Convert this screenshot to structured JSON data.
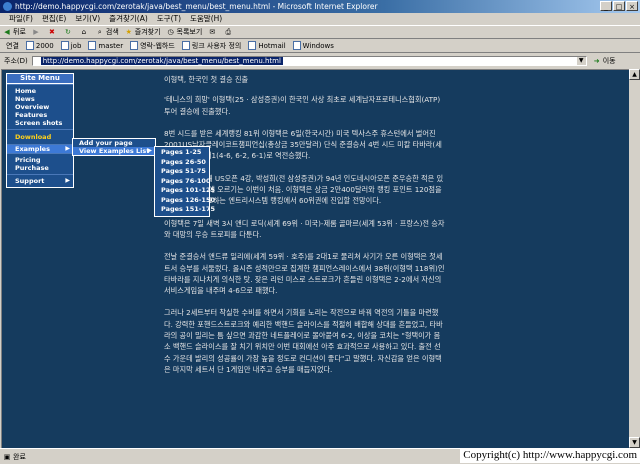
{
  "window": {
    "title": "http://demo.happycgi.com/zerotak/java/best_menu/best_menu.html - Microsoft Internet Explorer"
  },
  "menubar": [
    "파일(F)",
    "편집(E)",
    "보기(V)",
    "즐겨찾기(A)",
    "도구(T)",
    "도움말(H)"
  ],
  "toolbar": {
    "back": "뒤로",
    "search": "검색",
    "favorites": "즐겨찾기",
    "history": "목록보기"
  },
  "links": {
    "label": "연결",
    "items": [
      "2000",
      "job",
      "master",
      "영락-웹하드",
      "링크 사용자 정의",
      "Hotmail",
      "Windows"
    ]
  },
  "address": {
    "label": "주소(D)",
    "url": "http://demo.happycgi.com/zerotak/java/best_menu/best_menu.html",
    "go": "이동"
  },
  "site_menu": {
    "header": "Site Menu",
    "group1": [
      "Home",
      "News",
      "Overview",
      "Features",
      "Screen shots"
    ],
    "download": "Download",
    "examples": "Examples",
    "group2": [
      "Pricing",
      "Purchase"
    ],
    "support": "Support",
    "examples_sub": [
      "Add your page",
      "View Examples List"
    ],
    "pages": [
      "Pages 1-25",
      "Pages 26-50",
      "Pages 51-75",
      "Pages 76-100",
      "Pages 101-125",
      "Pages 126-150",
      "Pages 151-175"
    ]
  },
  "article": {
    "title": "이형택, 한국인 첫 결승 진출",
    "p1": "'테니스의 희망' 이형택(25 · 삼성증권)이 한국인 사상 최초로 세계남자프로테니스협회(ATP) 투어 결승에 진출했다.",
    "p2": "8번 시드를 받은 세계랭킹 81위 이형택은 6일(한국시간) 미국 텍사스주 휴스턴에서 벌어진 2001US남자클레이코트챔피언십(총상금 35만달러) 단식 준결승서 4번 시드 미칼 타바라(세계 73위)에 2대1(4-6, 6-2, 6-1)로 역전승했다.",
    "p3": "이형택은 지난해 US오픈 4강, 박성희(전 삼성증권)가 94년 인도네시아오픈 준우승한 적은 있으나 투어 결승에 오르기는 이번이 처음. 이형택은 상금 2만400달러와 랭킹 포인트 120점을 확보해 9일 발표하는 엔트리시스템 랭킹에서 60위권에 진입할 전망이다.",
    "p4": "이형택은 7일 새벽 3시 앤디 로딕(세계 69위 · 미국)-제롬 골마르(세계 53위 · 프랑스)전 승자와 대망의 우승 트로피를 다툰다.",
    "p5": "전날 준결승서 앤드류 일리에(세계 59위 · 호주)를 2대1로 물리쳐 사기가 오른 이형택은 첫세트서 승부를 서둘렀다. 올시즌 성적만으로 집계한 챔피언스레이스에서 38위(이형택 118위)인 타바라를 지나치게 의식한 탓. 잦은 리턴 미스로 스트로크가 흔들린 이형택은 2-2에서 자신의 서비스게임을 내주며 4-6으로 패했다.",
    "p6": "그러나 2세트부터 착실한 수비를 하면서 기회를 노리는 작전으로 바꿔 역전의 기틀을 마련했다. 강력한 포핸드스트로크와 예리한 백핸드 슬라이스를 적절히 배합해 상대를 흔들었고, 타바라의 공이 밀리는 틈 싶으면 과감한 네트플레이로 몰아붙여 6-2, 이상을 코치는 \"형택이가 몸소 백핸드 슬라이스를 잘 치기 위치만 이번 대회에선 아주 효과적으로 사용하고 있다. 출전 선수 가운데 발리의 성공률이 가장 높을 정도로 컨디션이 좋다\"고 말했다. 자신감을 얻은 이형택은 마지막 세트서 단 1게임만 내주고 승부를 매듭지었다."
  },
  "status": {
    "text": "완료",
    "copyright": "Copyright(c) http://www.happycgi.com"
  },
  "colors": {
    "page_bg": "#153b5e",
    "menu_bg": "#1d4f8c",
    "menu_selected": "#3d79d6",
    "download": "#ffd21a"
  }
}
